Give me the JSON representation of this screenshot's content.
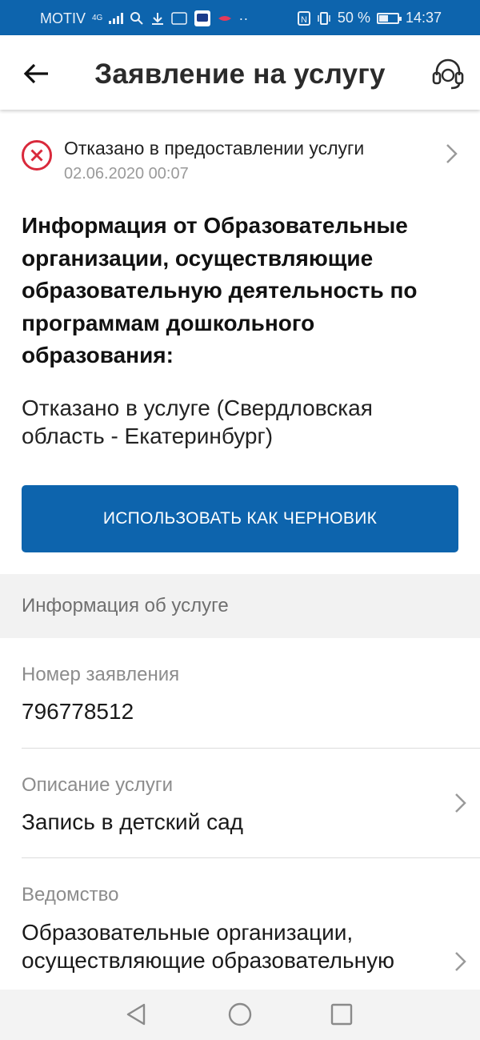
{
  "statusbar": {
    "carrier": "MOTIV",
    "net": "4G",
    "battery": "50 %",
    "battery_level": 0.5,
    "time": "14:37"
  },
  "appbar": {
    "title": "Заявление на услугу",
    "icons": {
      "back": "arrow-left-icon",
      "support": "headset-support-icon"
    }
  },
  "status": {
    "title": "Отказано в предоставлении услуги",
    "date": "02.06.2020 00:07",
    "icon": "x-circle-icon",
    "color": "#d9293b"
  },
  "info": {
    "heading": "Информация от Образовательные организации, осуществляющие образовательную деятельность по программам дошкольного образования:",
    "text": "Отказано в услуге (Свердловская область - Екатеринбург)"
  },
  "draft_button": {
    "label": "ИСПОЛЬЗОВАТЬ КАК ЧЕРНОВИК"
  },
  "section": {
    "title": "Информация об услуге"
  },
  "fields": [
    {
      "label": "Номер заявления",
      "value": "796778512"
    },
    {
      "label": "Описание услуги",
      "value": "Запись в детский сад"
    },
    {
      "label": "Ведомство",
      "value": "Образовательные организации, осуществляющие образовательную"
    }
  ],
  "colors": {
    "primary": "#0d64ad",
    "error": "#d9293b",
    "section_bg": "#f2f2f2"
  }
}
